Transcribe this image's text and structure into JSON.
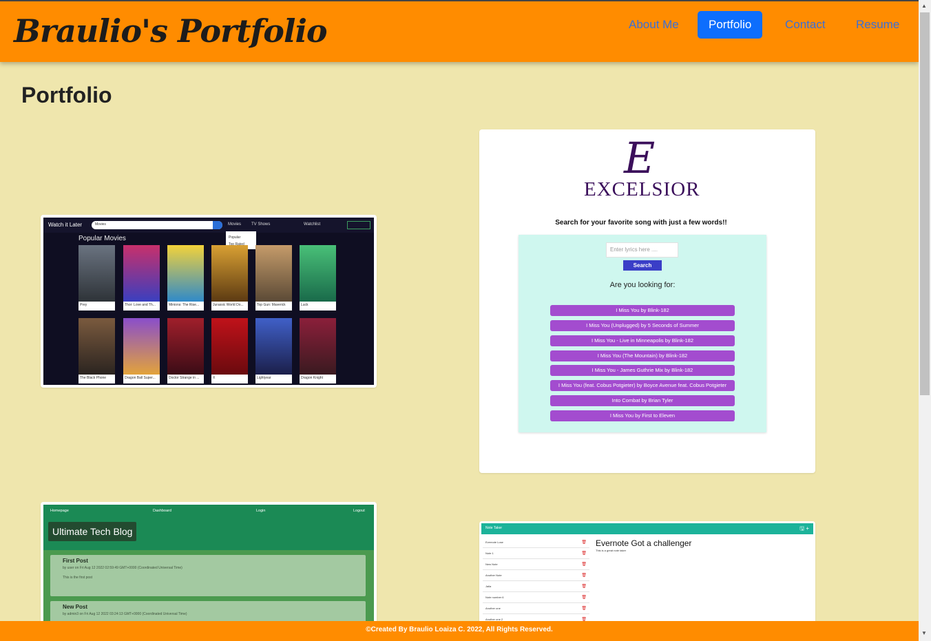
{
  "header": {
    "brand": "Braulio's Portfolio",
    "nav": [
      "About Me",
      "Portfolio",
      "Contact",
      "Resume"
    ],
    "active_nav": "Portfolio",
    "accent_color": "#ff8c00"
  },
  "main": {
    "title": "Portfolio"
  },
  "projects": {
    "movies": {
      "brand": "Watch it Later",
      "search_category": "Movies",
      "nav": [
        "Movies",
        "TV Shows",
        "Watchlist"
      ],
      "dropdown": [
        "Popular",
        "Top Rated"
      ],
      "section_title": "Popular Movies",
      "posters": [
        "Prey",
        "Thor: Love and Th...",
        "Minions: The Rise...",
        "Jurassic World Do...",
        "Top Gun: Maverick",
        "Luck",
        "The Black Phone",
        "Dragon Ball Super...",
        "Doctor Strange in ...",
        "X",
        "Lightyear",
        "Dragon Knight"
      ]
    },
    "excelsior": {
      "logo_letter": "E",
      "logo_text": "EXCELSIOR",
      "tagline": "Search for your favorite song with just a few words!!",
      "input_placeholder": "Enter lyrics here ....",
      "search_button": "Search",
      "question": "Are you looking for:",
      "results": [
        "I Miss You by Blink-182",
        "I Miss You (Unplugged) by 5 Seconds of Summer",
        "I Miss You - Live in Minneapolis by Blink-182",
        "I Miss You (The Mountain) by Blink-182",
        "I Miss You - James Guthrie Mix by Blink-182",
        "I Miss You (feat. Cobus Potgieter) by Boyce Avenue feat. Cobus Potgieter",
        "Into Combat by Brian Tyler",
        "I Miss You by First to Eleven"
      ]
    },
    "blog": {
      "nav": [
        "Homepage",
        "Dashboard",
        "Login",
        "Logout"
      ],
      "title": "Ultimate Tech Blog",
      "posts": [
        {
          "title": "First Post",
          "meta": "by user on Fri Aug 12 2022 02:59:49 GMT+0000 (Coordinated Universal Time)",
          "body": "This is the first post"
        },
        {
          "title": "New Post",
          "meta": "by admin3 on Fri Aug 12 2022 03:24:13 GMT+0000 (Coordinated Universal Time)",
          "body": ""
        }
      ]
    },
    "notes": {
      "title": "Note Taker",
      "list": [
        "Evernote Lose",
        "Note 1",
        "New Note",
        "Another Note",
        "Jaila",
        "Note number 6",
        "Another one",
        "Another one 2"
      ],
      "note_title": "Evernote Got a challenger",
      "note_body": "This is a great note taker"
    }
  },
  "footer": {
    "text": "©Created By Braulio Loaiza C. 2022, All Rights Reserved."
  }
}
